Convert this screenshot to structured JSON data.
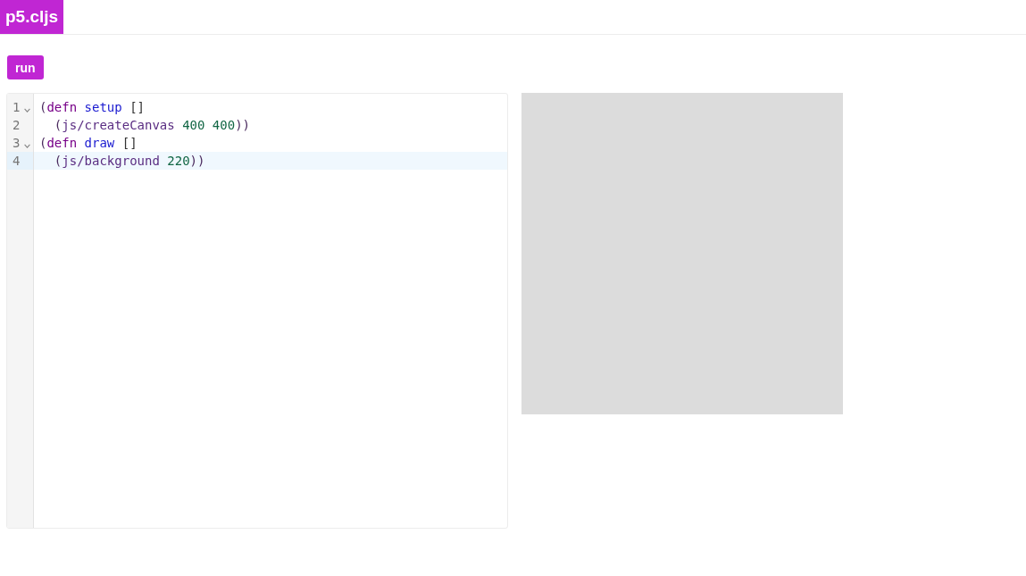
{
  "header": {
    "logo": "p5.cljs"
  },
  "toolbar": {
    "run_button": "run"
  },
  "editor": {
    "lines": [
      {
        "number": "1",
        "foldable": true,
        "active": false,
        "tokens": [
          {
            "kind": "open",
            "text": "("
          },
          {
            "kind": "keyword",
            "text": "defn"
          },
          {
            "kind": "def",
            "text": "setup"
          },
          {
            "kind": "bracket",
            "text": "[]"
          }
        ],
        "children": [
          {
            "number": "2",
            "foldable": false,
            "active": false,
            "tokens": [
              {
                "kind": "open",
                "text": "("
              },
              {
                "kind": "symbol",
                "text": "js/createCanvas"
              },
              {
                "kind": "number",
                "text": "400"
              },
              {
                "kind": "number",
                "text": "400"
              },
              {
                "kind": "close",
                "text": "))"
              }
            ]
          }
        ]
      },
      {
        "number": "3",
        "foldable": true,
        "active": false,
        "tokens": [
          {
            "kind": "open",
            "text": "("
          },
          {
            "kind": "keyword",
            "text": "defn"
          },
          {
            "kind": "def",
            "text": "draw"
          },
          {
            "kind": "bracket",
            "text": "[]"
          }
        ],
        "children": [
          {
            "number": "4",
            "foldable": false,
            "active": true,
            "tokens": [
              {
                "kind": "open",
                "text": "("
              },
              {
                "kind": "symbol",
                "text": "js/background"
              },
              {
                "kind": "number",
                "text": "220"
              },
              {
                "kind": "close",
                "text": "))"
              }
            ]
          }
        ]
      }
    ]
  }
}
